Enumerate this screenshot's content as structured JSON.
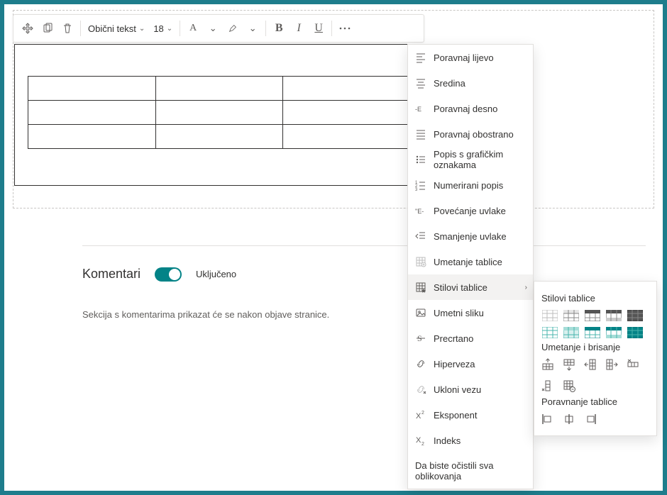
{
  "toolbar": {
    "text_style": "Obični tekst",
    "font_size": "18"
  },
  "comments": {
    "heading": "Komentari",
    "toggle_label": "Uključeno",
    "description": "Sekcija s komentarima prikazat će se nakon objave stranice."
  },
  "menu": {
    "items": [
      {
        "label": "Poravnaj lijevo",
        "icon": "align-left"
      },
      {
        "label": "Sredina",
        "icon": "align-center"
      },
      {
        "label": "Poravnaj desno",
        "icon": "align-right"
      },
      {
        "label": "Poravnaj obostrano",
        "icon": "align-justify"
      },
      {
        "label": "Popis s grafičkim oznakama",
        "icon": "bullet-list"
      },
      {
        "label": "Numerirani popis",
        "icon": "number-list"
      },
      {
        "label": "Povećanje uvlake",
        "icon": "indent-inc"
      },
      {
        "label": "Smanjenje uvlake",
        "icon": "indent-dec"
      },
      {
        "label": "Umetanje tablice",
        "icon": "table-insert"
      },
      {
        "label": "Stilovi tablice",
        "icon": "table-styles",
        "submenu": true,
        "active": true
      },
      {
        "label": "Umetni sliku",
        "icon": "image"
      },
      {
        "label": "Precrtano",
        "icon": "strike"
      },
      {
        "label": "Hiperveza",
        "icon": "link"
      },
      {
        "label": "Ukloni vezu",
        "icon": "unlink"
      },
      {
        "label": "Eksponent",
        "icon": "sup"
      },
      {
        "label": "Indeks",
        "icon": "sub"
      }
    ],
    "footer": "Da biste očistili sva oblikovanja"
  },
  "submenu": {
    "styles_heading": "Stilovi tablice",
    "insert_heading": "Umetanje i brisanje",
    "align_heading": "Poravnanje tablice"
  }
}
